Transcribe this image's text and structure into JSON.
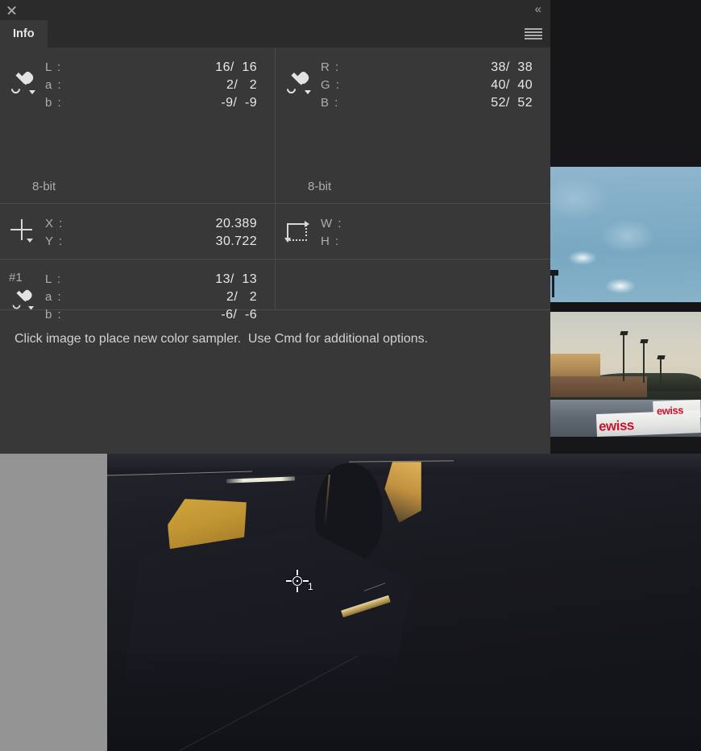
{
  "panel": {
    "title_tab": "Info",
    "close_icon": "close-icon",
    "collapse_icon": "double-chevron-left-icon",
    "menu_icon": "hamburger-menu-icon",
    "hint": "Click image to place new color sampler.  Use Cmd for additional options."
  },
  "readouts": {
    "color_primary": {
      "icon": "eyedropper-icon",
      "rows": [
        {
          "label": "L :",
          "value": "16/  16"
        },
        {
          "label": "a :",
          "value": "2/   2"
        },
        {
          "label": "b :",
          "value": "-9/  -9"
        }
      ],
      "bit_depth": "8-bit"
    },
    "color_secondary": {
      "icon": "eyedropper-icon",
      "rows": [
        {
          "label": "R :",
          "value": "38/  38"
        },
        {
          "label": "G :",
          "value": "40/  40"
        },
        {
          "label": "B :",
          "value": "52/  52"
        }
      ],
      "bit_depth": "8-bit"
    },
    "position": {
      "icon": "crosshair-icon",
      "rows": [
        {
          "label": "X :",
          "value": "20.389"
        },
        {
          "label": "Y :",
          "value": "30.722"
        }
      ]
    },
    "dimensions": {
      "icon": "marquee-size-icon",
      "rows": [
        {
          "label": "W :",
          "value": ""
        },
        {
          "label": "H :",
          "value": ""
        }
      ]
    },
    "sampler_1": {
      "index": "#1",
      "icon": "eyedropper-icon",
      "rows": [
        {
          "label": "L :",
          "value": "13/  13"
        },
        {
          "label": "a :",
          "value": "2/   2"
        },
        {
          "label": "b :",
          "value": "-6/  -6"
        }
      ]
    }
  },
  "canvas": {
    "sampler_marker_label": "1"
  },
  "colors": {
    "panel_bg": "#383838",
    "panel_chrome": "#2b2b2b",
    "divider": "#4a4a4a",
    "label_text": "#adadad",
    "value_text": "#e8e8e8",
    "margin_gray": "#949494",
    "swiss_red": "#c9142f"
  }
}
